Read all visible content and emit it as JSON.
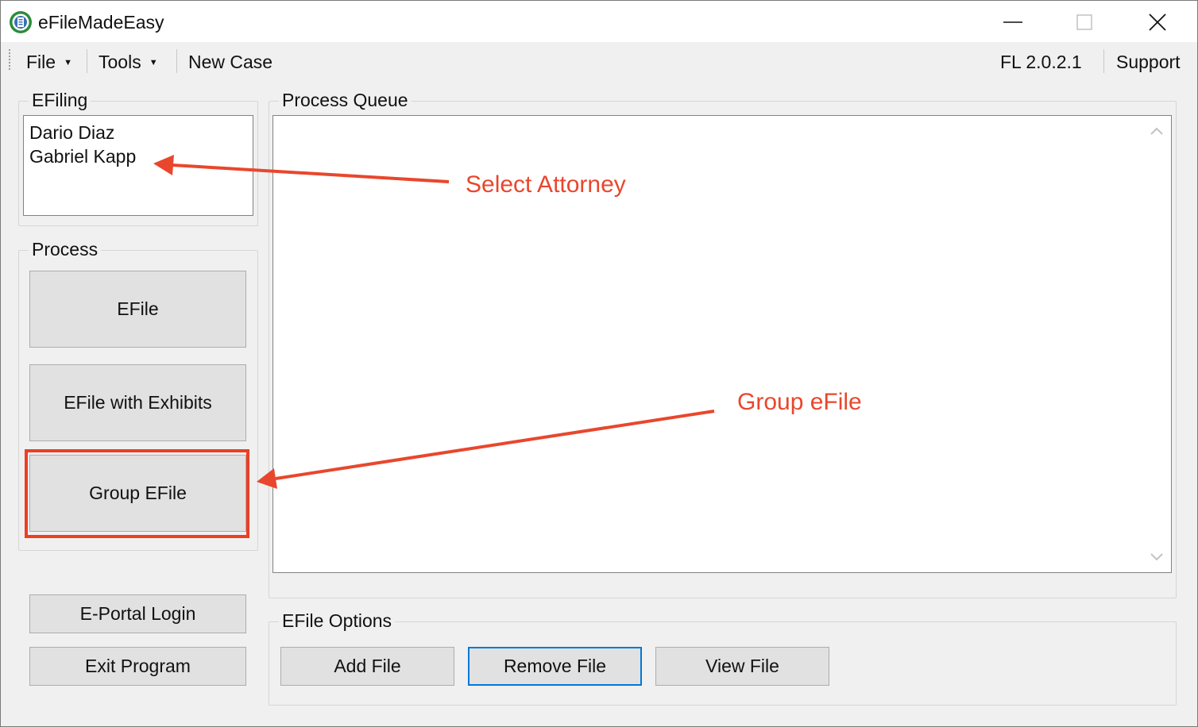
{
  "window": {
    "title": "eFileMadeEasy",
    "icon": "efile-globe-icon",
    "controls": [
      "minimize-icon",
      "maximize-icon",
      "close-icon"
    ]
  },
  "menubar": {
    "file": "File",
    "tools": "Tools",
    "new_case": "New Case",
    "version": "FL  2.0.2.1",
    "support": "Support"
  },
  "efiling": {
    "label": "EFiling",
    "attorneys": [
      "Dario Diaz",
      "Gabriel Kapp"
    ]
  },
  "process": {
    "label": "Process",
    "efile": "EFile",
    "efile_exhibits": "EFile with Exhibits",
    "group_efile": "Group EFile"
  },
  "bottom_left": {
    "portal_login": "E-Portal Login",
    "exit": "Exit Program"
  },
  "queue": {
    "label": "Process Queue"
  },
  "options": {
    "label": "EFile Options",
    "add": "Add File",
    "remove": "Remove File",
    "view": "View File"
  },
  "annotations": {
    "select_attorney": "Select Attorney",
    "group_efile": "Group eFile",
    "color": "#e8472d"
  }
}
